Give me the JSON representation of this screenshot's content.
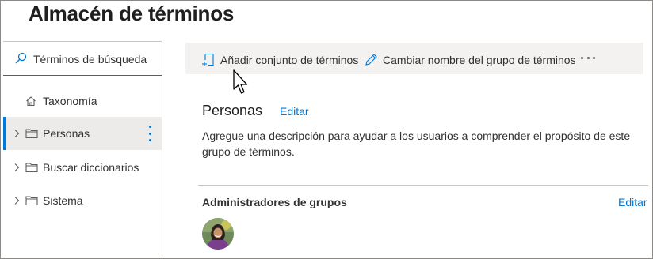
{
  "header": {
    "title": "Almacén de términos"
  },
  "search": {
    "placeholder": "Términos de búsqueda",
    "icon": "search-icon"
  },
  "nav": {
    "items": [
      {
        "label": "Taxonomía",
        "icon": "home-icon",
        "selected": false
      },
      {
        "label": "Personas",
        "icon": "folder-icon",
        "selected": true
      },
      {
        "label": "Buscar diccionarios",
        "icon": "folder-icon",
        "selected": false
      },
      {
        "label": "Sistema",
        "icon": "folder-icon",
        "selected": false
      }
    ]
  },
  "toolbar": {
    "add_term_set": "Añadir conjunto de términos",
    "rename_group": "Cambiar nombre del grupo de términos",
    "more": "..."
  },
  "group": {
    "name": "Personas",
    "edit_label": "Editar",
    "description": "Agregue una descripción para ayudar a los usuarios a comprender el propósito de este grupo de términos."
  },
  "admins": {
    "title": "Administradores de grupos",
    "edit_label": "Editar"
  },
  "colors": {
    "accent": "#0078d4",
    "selected_bg": "#edebe9",
    "toolbar_bg": "#f3f2f1"
  }
}
